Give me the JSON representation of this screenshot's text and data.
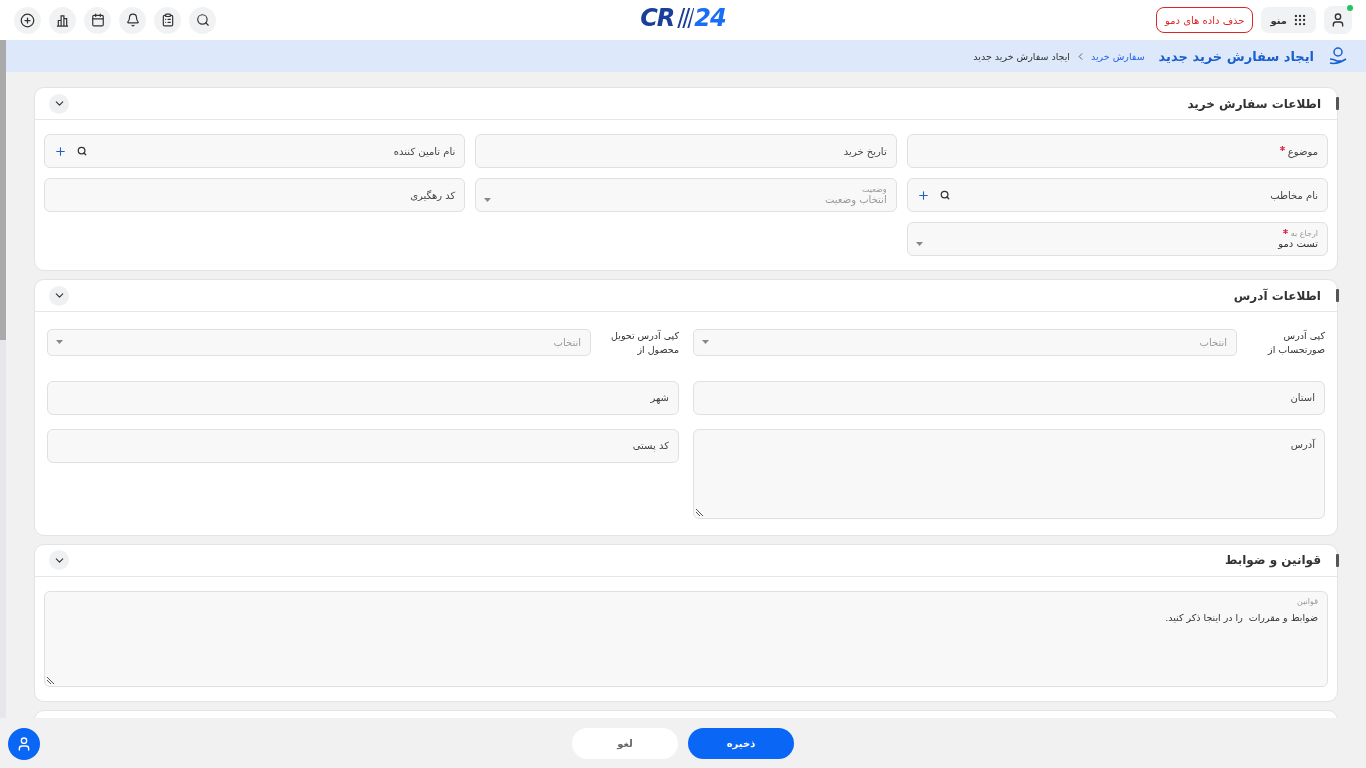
{
  "topbar": {
    "user_online": true,
    "menu_label": "منو",
    "demo_button": "حذف داده های دمو",
    "logo": {
      "prefix": "CR",
      "suffix": "24"
    }
  },
  "page_header": {
    "title": "ایجاد سفارش خرید جدید",
    "breadcrumbs": [
      {
        "label": "سفارش خرید",
        "current": false
      },
      {
        "label": "ایجاد سفارش خرید جدید",
        "current": true
      }
    ]
  },
  "sections": [
    {
      "kind": "fields",
      "title": "اطلاعات سفارش خرید",
      "expanded": true,
      "fields": [
        {
          "kind": "text",
          "label": "موضوع",
          "required": true
        },
        {
          "kind": "text",
          "label": "تاریخ خرید",
          "required": false
        },
        {
          "kind": "lookup",
          "label": "نام تامین کننده",
          "required": false
        },
        {
          "kind": "lookup",
          "label": "نام مخاطب",
          "required": false
        },
        {
          "kind": "select",
          "label": "وضعیت",
          "placeholder": "انتخاب وضعیت",
          "required": false
        },
        {
          "kind": "text",
          "label": "کد رهگیری",
          "required": false
        },
        {
          "kind": "select",
          "label": "ارجاع به",
          "value": "تست دمو",
          "required": true
        }
      ]
    },
    {
      "kind": "address",
      "title": "اطلاعات آدرس",
      "expanded": true,
      "copy_from": [
        {
          "label": "کپی آدرس صورتحساب از",
          "placeholder": "انتخاب"
        },
        {
          "label": "کپی آدرس تحویل محصول از",
          "placeholder": "انتخاب"
        }
      ],
      "fields": [
        {
          "kind": "text",
          "label": "استان"
        },
        {
          "kind": "text",
          "label": "شهر"
        },
        {
          "kind": "textarea",
          "label": "آدرس"
        },
        {
          "kind": "text",
          "label": "کد پستی"
        }
      ]
    },
    {
      "kind": "terms",
      "title": "قوانین و ضوابط",
      "expanded": true,
      "field": {
        "label": "قوانین",
        "value": "ضوابط و مقررات  را در اینجا ذکر کنید."
      }
    },
    {
      "kind": "partial"
    }
  ],
  "footer": {
    "buttons": [
      {
        "kind": "primary",
        "label": "ذخیره"
      },
      {
        "kind": "secondary",
        "label": "لغو"
      }
    ]
  }
}
